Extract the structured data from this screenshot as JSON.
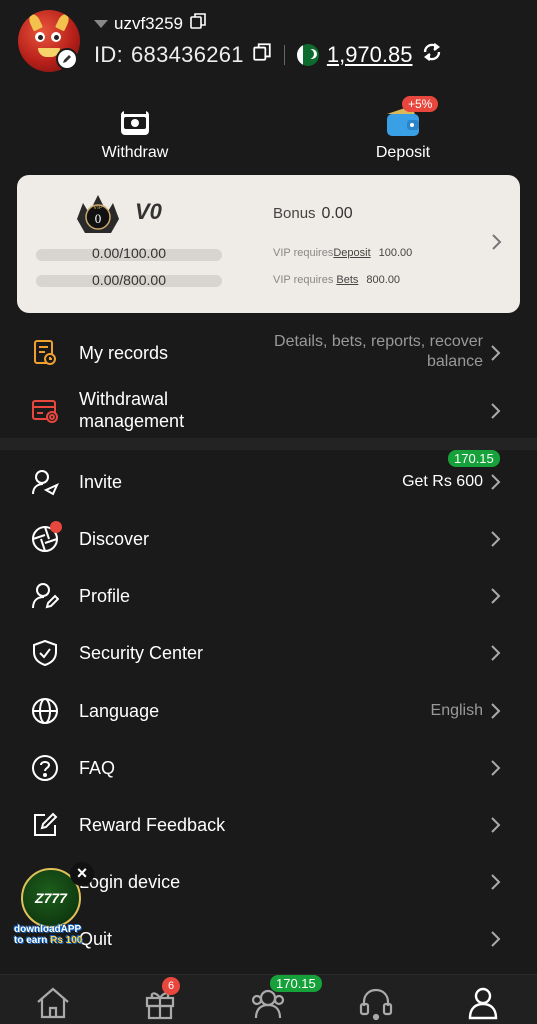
{
  "header": {
    "username": "uzvf3259",
    "id_label": "ID:",
    "id_value": "683436261",
    "balance": "1,970.85"
  },
  "quick_actions": {
    "withdraw_label": "Withdraw",
    "deposit_label": "Deposit",
    "deposit_badge": "+5%"
  },
  "vip": {
    "badge_text": "VIP",
    "badge_level": "0",
    "level": "V0",
    "bonus_label": "Bonus",
    "bonus_value": "0.00",
    "deposit_progress_text": "0.00/100.00",
    "deposit_progress": 0,
    "bets_progress_text": "0.00/800.00",
    "bets_progress": 0,
    "req_prefix": "VIP requires",
    "req_deposit_link": "Deposit",
    "req_deposit_amount": "100.00",
    "req_bets_link": "Bets",
    "req_bets_amount": "800.00"
  },
  "menu": {
    "records_label": "My records",
    "records_hint_line1": "Details, bets, reports, recover",
    "records_hint_line2": "balance",
    "withdrawal_mgmt_line1": "Withdrawal",
    "withdrawal_mgmt_line2": "management",
    "invite_label": "Invite",
    "invite_right": "Get Rs 600",
    "invite_badge": "170.15",
    "discover_label": "Discover",
    "profile_label": "Profile",
    "security_label": "Security Center",
    "language_label": "Language",
    "language_value": "English",
    "faq_label": "FAQ",
    "feedback_label": "Reward Feedback",
    "login_device_label": "Login device",
    "quit_label": "Quit"
  },
  "float_ad": {
    "logo_text": "Z777",
    "close": "×",
    "line1": "downloadAPP",
    "line2_prefix": "to earn ",
    "line2_amount": "Rs 100"
  },
  "tabbar": {
    "gift_badge": "6",
    "agent_badge": "170.15"
  },
  "colors": {
    "background": "#1a1a1a",
    "card": "#efebe6",
    "green_badge": "#16a13a",
    "red_badge": "#e8473e",
    "records_icon": "#f0a030",
    "withdraw_icon": "#e8473e"
  }
}
